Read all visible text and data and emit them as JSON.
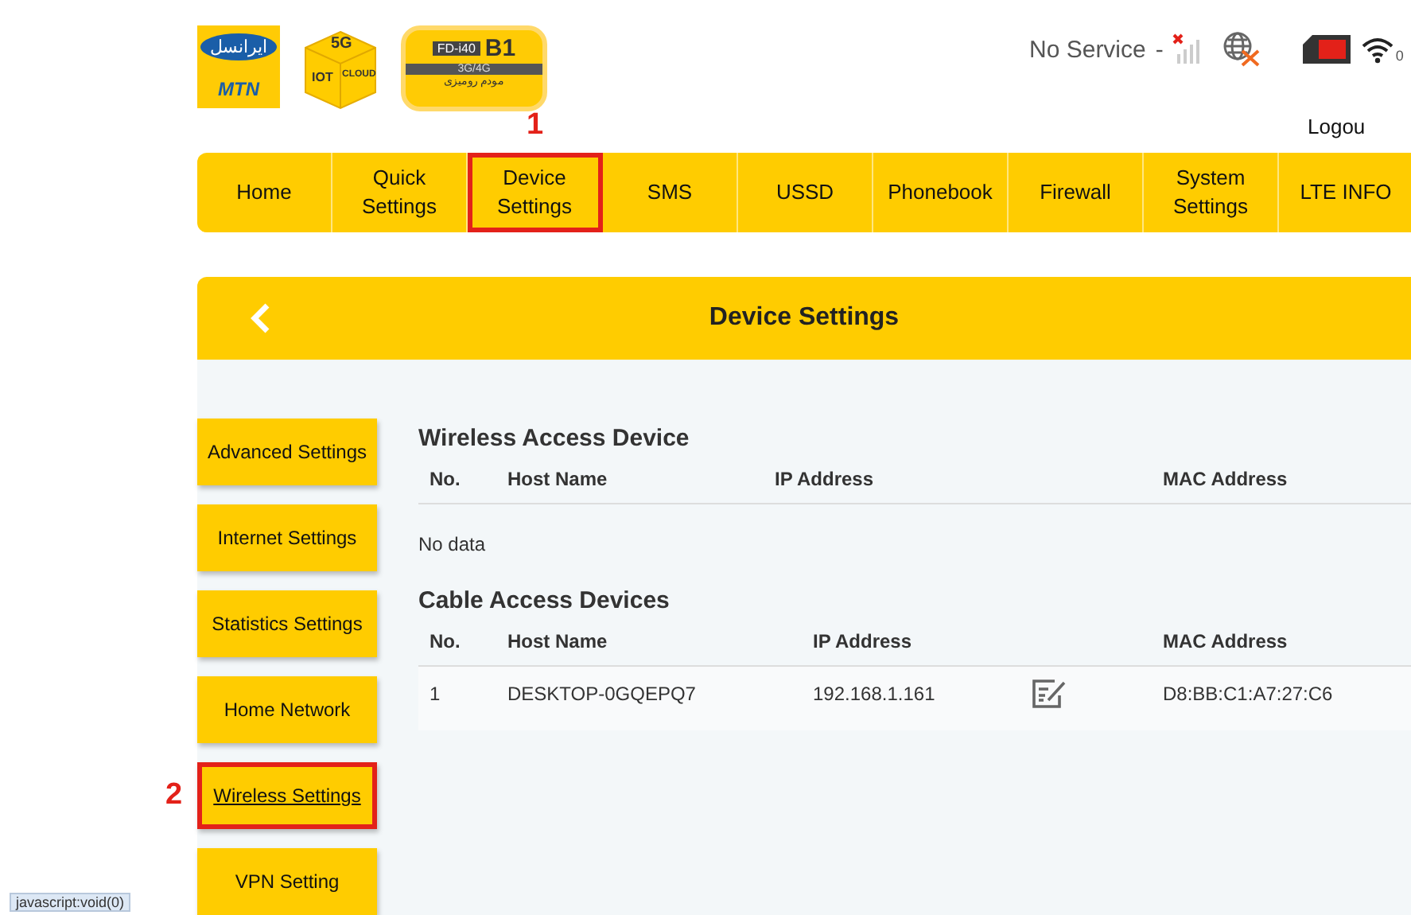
{
  "header": {
    "logos": {
      "operator": {
        "name_fa": "ایرانسل",
        "name": "MTN"
      },
      "cube": {
        "top": "5G",
        "left": "IOT",
        "right": "CLOUD"
      },
      "modem": {
        "model": "FD-i40",
        "band": "B1",
        "network": "3G/4G",
        "caption": "مودم رومیزی"
      }
    },
    "status": {
      "text": "No Service",
      "separator": "-",
      "wifi_clients": "0"
    },
    "logout": "Logou"
  },
  "nav": [
    {
      "label": "Home"
    },
    {
      "label": "Quick\nSettings"
    },
    {
      "label": "Device\nSettings",
      "annotation": "1"
    },
    {
      "label": "SMS"
    },
    {
      "label": "USSD"
    },
    {
      "label": "Phonebook"
    },
    {
      "label": "Firewall"
    },
    {
      "label": "System\nSettings"
    },
    {
      "label": "LTE INFO"
    }
  ],
  "page_title": "Device Settings",
  "sidebar": [
    {
      "label": "Advanced Settings",
      "hovered": false
    },
    {
      "label": "Internet Settings",
      "hovered": false
    },
    {
      "label": "Statistics Settings",
      "hovered": false
    },
    {
      "label": "Home Network",
      "hovered": false
    },
    {
      "label": "Wireless Settings",
      "hovered": true,
      "annotation": "2"
    },
    {
      "label": "VPN Setting",
      "hovered": false
    }
  ],
  "tables": [
    {
      "title": "Wireless Access Device",
      "columns": [
        "No.",
        "Host Name",
        "IP Address",
        "",
        "MAC Address"
      ],
      "empty_text": "No data"
    },
    {
      "title": "Cable Access Devices",
      "columns": [
        "No.",
        "Host Name",
        "IP Address",
        "",
        "MAC Address"
      ],
      "rows": [
        {
          "no": "1",
          "host_name": "DESKTOP-0GQEPQ7",
          "ip_address": "192.168.1.161",
          "mac_address": "D8:BB:C1:A7:27:C6"
        }
      ]
    }
  ],
  "status_link": "javascript:void(0)"
}
